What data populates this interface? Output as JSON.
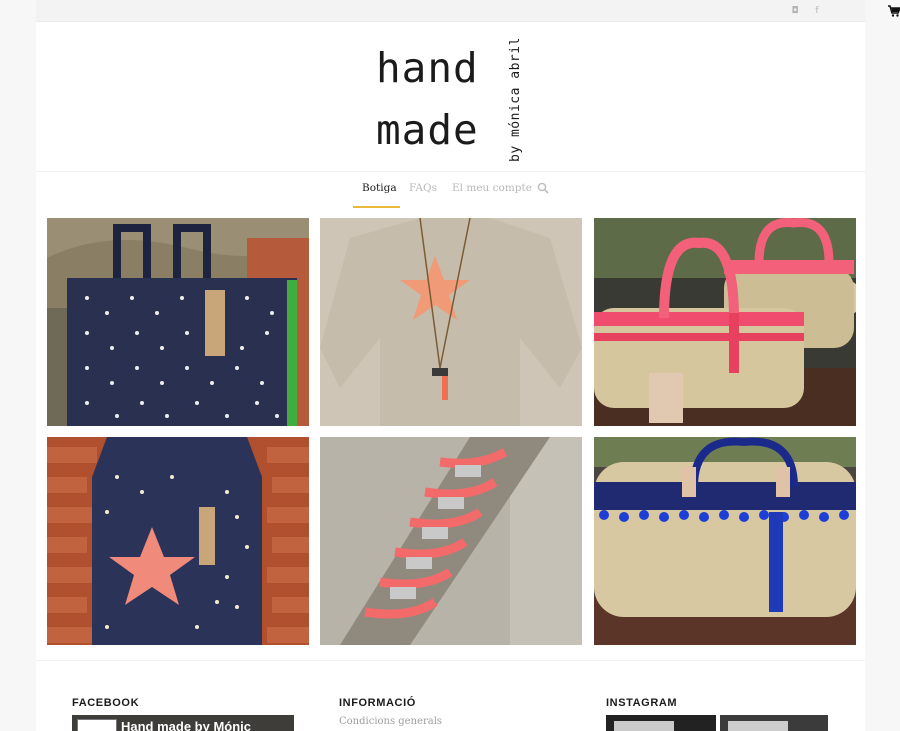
{
  "logo": {
    "line1": "hand",
    "line2": "made",
    "byline": "by mónica abril"
  },
  "topbar": {
    "social": [
      {
        "icon": "instagram-icon",
        "glyph": "◘"
      },
      {
        "icon": "facebook-icon",
        "glyph": "f"
      }
    ],
    "cart_icon": "cart-icon"
  },
  "nav": {
    "items": [
      {
        "label": "Botiga",
        "active": true
      },
      {
        "label": "FAQs",
        "active": false
      },
      {
        "label": "El meu compte",
        "active": false
      }
    ],
    "search_icon": "search-icon",
    "accent_color": "#e9b83a"
  },
  "products": [
    {
      "name": "star-print tote bag"
    },
    {
      "name": "beige star sweater with necklace"
    },
    {
      "name": "coral pom-pom straw baskets"
    },
    {
      "name": "navy star bag with coral star"
    },
    {
      "name": "coral knot bracelets"
    },
    {
      "name": "navy pom-pom straw basket"
    }
  ],
  "footer": {
    "facebook_title": "FACEBOOK",
    "facebook_widget_name": "Hand made by Mónic",
    "info_title": "INFORMACIÓ",
    "info_links": [
      "Condicions generals"
    ],
    "instagram_title": "INSTAGRAM"
  }
}
